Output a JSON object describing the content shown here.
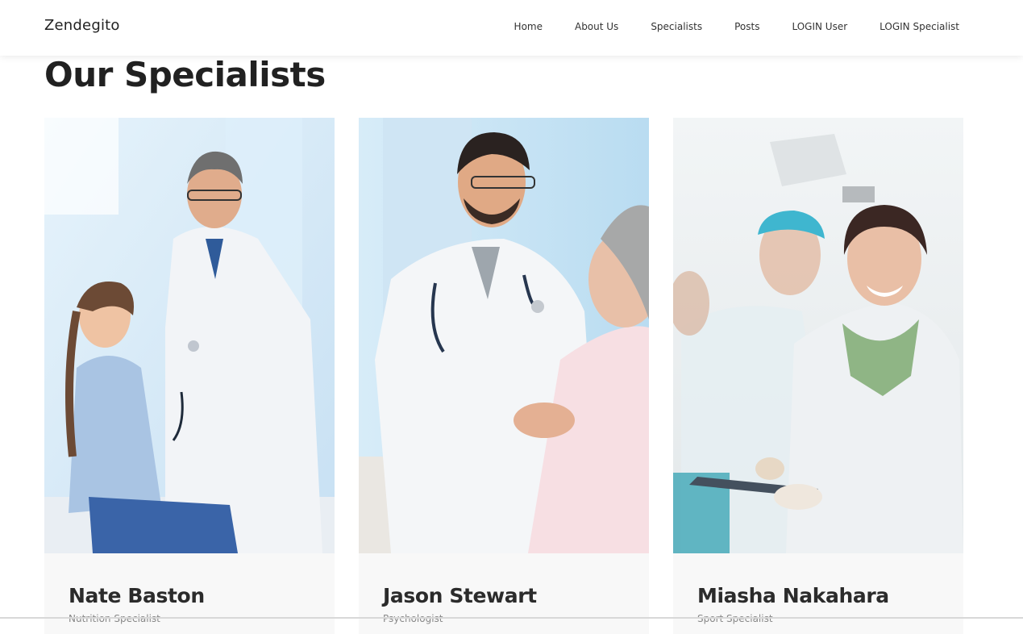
{
  "brand": "Zendegito",
  "nav": {
    "items": [
      "Home",
      "About Us",
      "Specialists",
      "Posts",
      "LOGIN User",
      "LOGIN Specialist"
    ]
  },
  "page_title": "Our Specialists",
  "specialists": [
    {
      "name": "Nate Baston",
      "role": "Nutrition Specialist"
    },
    {
      "name": "Jason Stewart",
      "role": "Psychologist"
    },
    {
      "name": "Miasha Nakahara",
      "role": "Sport Specialist"
    }
  ],
  "colors": {
    "text_dark": "#212121",
    "card_bg": "#f8f8f8",
    "photo_sky": "#cfe6f6",
    "lab_coat": "#f1f3f6",
    "scrub_teal": "#3fb6cf"
  }
}
